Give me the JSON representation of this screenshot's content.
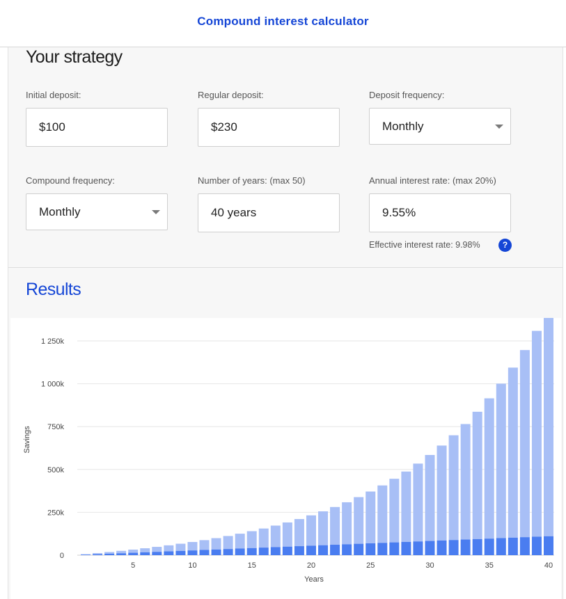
{
  "header": {
    "title": "Compound interest calculator"
  },
  "strategy": {
    "title": "Your strategy",
    "fields": {
      "initial_deposit": {
        "label": "Initial deposit:",
        "value": "$100"
      },
      "regular_deposit": {
        "label": "Regular deposit:",
        "value": "$230"
      },
      "deposit_frequency": {
        "label": "Deposit frequency:",
        "value": "Monthly"
      },
      "compound_frequency": {
        "label": "Compound frequency:",
        "value": "Monthly"
      },
      "number_of_years": {
        "label": "Number of years: (max 50)",
        "value": "40 years"
      },
      "annual_interest_rate": {
        "label": "Annual interest rate: (max 20%)",
        "value": "9.55%"
      }
    },
    "effective_rate": "Effective interest rate: 9.98%",
    "help_icon": {
      "icon": "question-icon",
      "glyph": "?"
    }
  },
  "results": {
    "title": "Results"
  },
  "colors": {
    "accent": "#1546d6",
    "deposits_bar": "#4a7df0",
    "interest_bar": "#a8bff6"
  },
  "chart_data": {
    "type": "bar",
    "stacked": true,
    "xlabel": "Years",
    "ylabel": "Savings",
    "ylim": [
      0,
      1250000
    ],
    "y_ticks": [
      0,
      250000,
      500000,
      750000,
      1000000,
      1250000
    ],
    "y_tick_labels": [
      "0",
      "250k",
      "500k",
      "750k",
      "1 000k",
      "1 250k"
    ],
    "x_ticks": [
      5,
      10,
      15,
      20,
      25,
      30,
      35,
      40
    ],
    "x_tick_labels": [
      "5",
      "10",
      "15",
      "20",
      "25",
      "30",
      "35",
      "40"
    ],
    "grid": true,
    "categories": [
      1,
      2,
      3,
      4,
      5,
      6,
      7,
      8,
      9,
      10,
      11,
      12,
      13,
      14,
      15,
      16,
      17,
      18,
      19,
      20,
      21,
      22,
      23,
      24,
      25,
      26,
      27,
      28,
      29,
      30,
      31,
      32,
      33,
      34,
      35,
      36,
      37,
      38,
      39,
      40
    ],
    "series": [
      {
        "values": [
          2860,
          5620,
          8380,
          11140,
          13900,
          16660,
          19420,
          22180,
          24940,
          27700,
          30460,
          33220,
          35980,
          38740,
          41500,
          44260,
          47020,
          49780,
          52540,
          55300,
          58060,
          60820,
          63580,
          66340,
          69100,
          71860,
          74620,
          77380,
          80140,
          82900,
          85660,
          88420,
          91180,
          93940,
          96700,
          99460,
          102220,
          104980,
          107740,
          110500
        ]
      },
      {
        "values": [
          3000,
          6300,
          10000,
          14100,
          18600,
          23600,
          29100,
          35200,
          41800,
          49200,
          57200,
          66100,
          75900,
          86600,
          98400,
          111300,
          125500,
          141100,
          158200,
          177000,
          197600,
          220200,
          245000,
          272300,
          302200,
          335000,
          371100,
          410600,
          454000,
          501600,
          553800,
          611000,
          673800,
          742700,
          818300,
          901100,
          992000,
          1091600,
          1200800,
          1320600
        ]
      }
    ]
  }
}
